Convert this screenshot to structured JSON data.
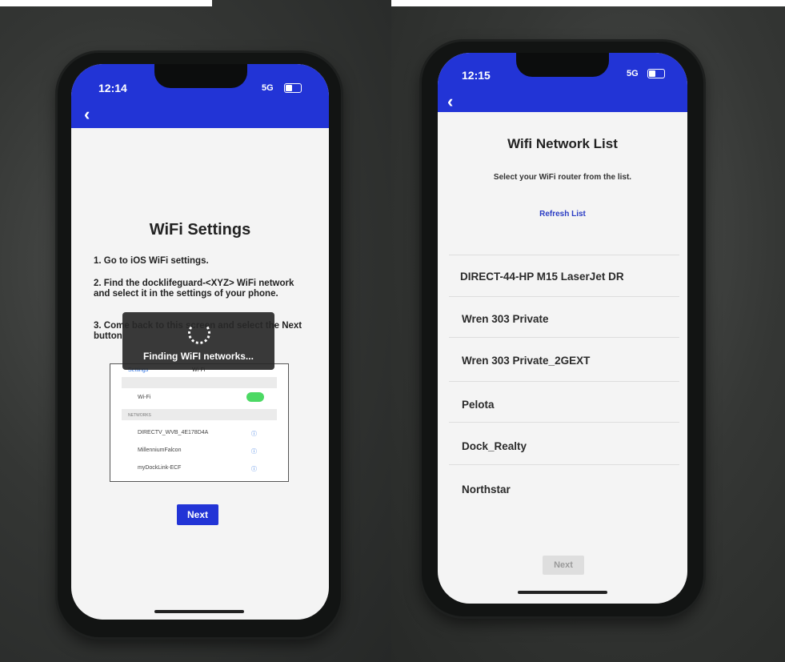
{
  "left": {
    "status": {
      "time": "12:14",
      "network": "5G"
    },
    "title": "WiFi Settings",
    "steps": [
      "1. Go to iOS WiFi settings.",
      "2. Find the docklifeguard-<XYZ> WiFi network and select it in the settings of your phone.",
      "3. Come back to this screen and select the Next button"
    ],
    "hud_text": "Finding WiFI networks...",
    "figure": {
      "back_label": "Settings",
      "header": "Wi-Fi",
      "wifi_label": "Wi-Fi",
      "networks_header": "NETWORKS",
      "networks": [
        "DIRECTV_WVB_4E178D4A",
        "MillenniumFalcon",
        "myDockLink-ECF"
      ]
    },
    "next_label": "Next"
  },
  "right": {
    "status": {
      "time": "12:15",
      "network": "5G"
    },
    "title": "Wifi Network List",
    "subtitle": "Select your WiFi router from the list.",
    "refresh_label": "Refresh List",
    "networks": [
      "DIRECT-44-HP M15 LaserJet DR",
      "Wren 303 Private",
      "Wren 303 Private_2GEXT",
      "Pelota",
      "Dock_Realty",
      "Northstar"
    ],
    "next_label": "Next"
  },
  "colors": {
    "header_blue": "#2234d6",
    "link_blue": "#2a3cc4",
    "toggle_green": "#4cd964"
  }
}
